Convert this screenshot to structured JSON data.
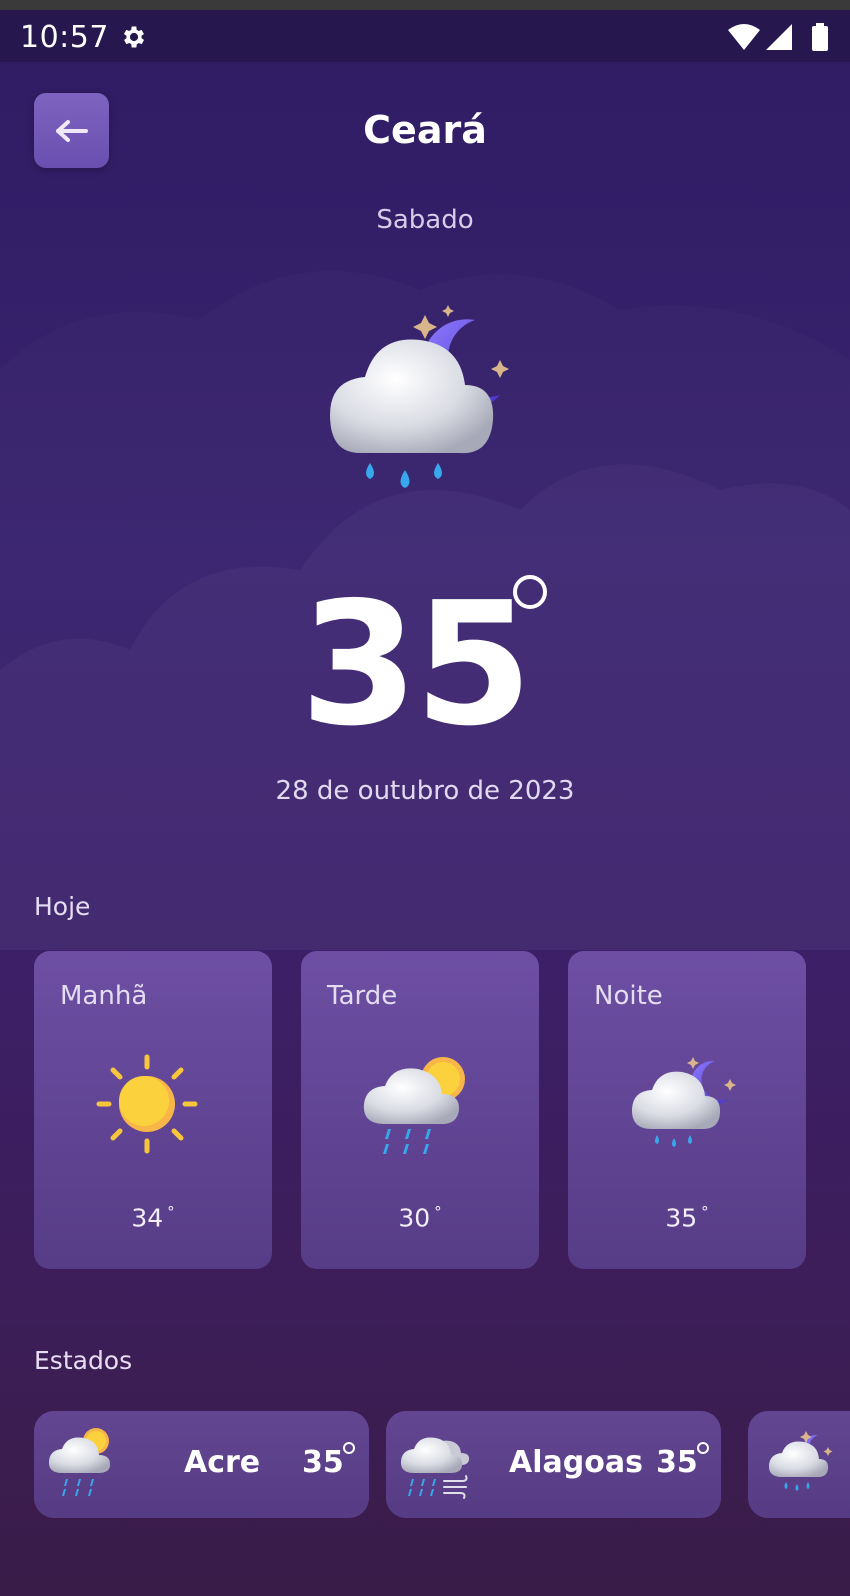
{
  "status_bar": {
    "time": "10:57",
    "icons": [
      "gear-icon",
      "wifi-icon",
      "signal-icon",
      "battery-icon"
    ]
  },
  "header": {
    "title": "Ceará",
    "back_icon": "arrow-left-icon"
  },
  "main": {
    "day": "Sabado",
    "icon": "rain-cloud-moon-icon",
    "temperature": "35",
    "degree_symbol": "°",
    "date": "28 de outubro de 2023"
  },
  "today": {
    "title": "Hoje",
    "cards": [
      {
        "label": "Manhã",
        "icon": "sun-icon",
        "temp": "34",
        "deg": "°"
      },
      {
        "label": "Tarde",
        "icon": "rain-cloud-sun-icon",
        "temp": "30",
        "deg": "°"
      },
      {
        "label": "Noite",
        "icon": "rain-cloud-moon-icon",
        "temp": "35",
        "deg": "°"
      }
    ]
  },
  "states": {
    "title": "Estados",
    "items": [
      {
        "name": "Acre",
        "temp": "35",
        "icon": "rain-cloud-sun-icon"
      },
      {
        "name": "Alagoas",
        "temp": "35",
        "icon": "wind-rain-cloud-icon"
      },
      {
        "name": "",
        "temp": "",
        "icon": "rain-cloud-moon-icon"
      }
    ]
  },
  "colors": {
    "background_top": "#2e1c63",
    "background_bottom": "#3a1c48",
    "accent_purple": "#7f63c0",
    "moon": "#6d53ee",
    "sun": "#f8c63c",
    "raindrop": "#38a8ec"
  }
}
